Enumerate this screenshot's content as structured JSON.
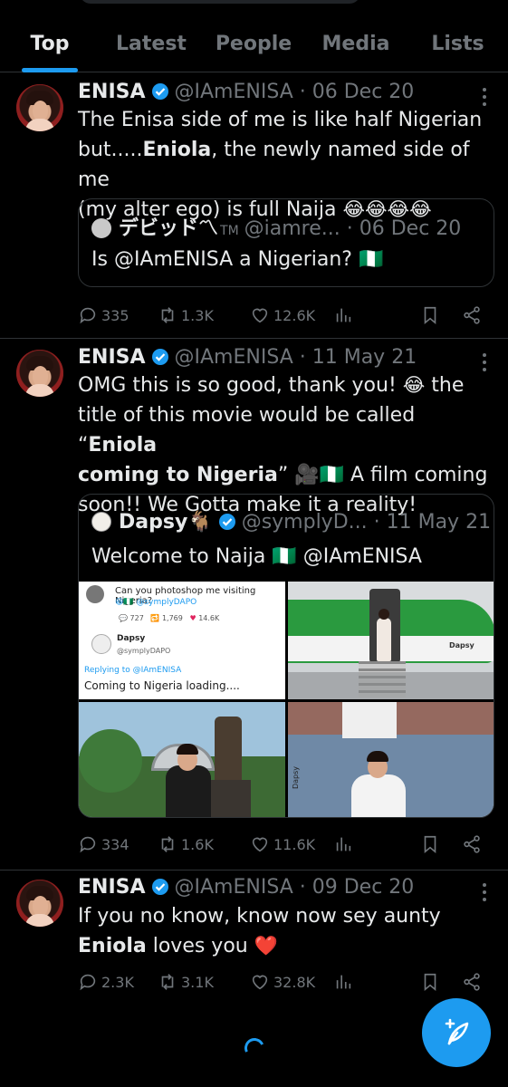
{
  "tabs": [
    {
      "label": "Top",
      "active": true
    },
    {
      "label": "Latest",
      "active": false
    },
    {
      "label": "People",
      "active": false
    },
    {
      "label": "Media",
      "active": false
    },
    {
      "label": "Lists",
      "active": false
    }
  ],
  "colors": {
    "accent": "#1d9bf0",
    "background": "#000000",
    "muted": "#71767b",
    "text": "#e7e9ea",
    "heart": "#e0245e"
  },
  "tweets": [
    {
      "name": "ENISA",
      "handle": "@IAmENISA",
      "date": "· 06 Dec 20",
      "text_lines": [
        "The Enisa side of me is like half Nigerian",
        {
          "pre": "but.....",
          "bold": "Eniola",
          "post": ", the newly named side of me"
        },
        {
          "pre": "(my alter ego) is full Naija ",
          "emoji": "😂😂😂😂"
        }
      ],
      "quote": {
        "name": "デビッド〽",
        "tm": "TM",
        "handle": "@iamre...",
        "date": "· 06 Dec 20",
        "text": "Is @IAmENISA a Nigerian? 🇳🇬"
      },
      "stats": {
        "replies": "335",
        "retweets": "1.3K",
        "likes": "12.6K"
      }
    },
    {
      "name": "ENISA",
      "handle": "@IAmENISA",
      "date": "· 11 May 21",
      "text_lines": [
        {
          "pre": "OMG this is so good, thank you! ",
          "emoji": "😂",
          "post": " the"
        },
        {
          "pre": "title of this movie would be called “",
          "bold": "Eniola"
        },
        {
          "bold": "coming to Nigeria",
          "post": "” 🎥🇳🇬 A film coming"
        },
        "soon!! We Gotta make it a reality!"
      ],
      "quote": {
        "name": "Dapsy🐐",
        "handle": "@symplyD...",
        "date": "· 11 May 21",
        "text": "Welcome to Naija 🇳🇬 @IAmENISA",
        "media": {
          "screenshot": {
            "question": "Can you photoshop me visiting Nigeria?",
            "sub_handle": "😆🇳🇬 @symplyDAPO",
            "stats": [
              "727",
              "1,769",
              "14.6K"
            ],
            "reply_name": "Dapsy",
            "reply_handle": "@symplyDAPO",
            "replying_to": "Replying to @IAmENISA",
            "reply_text": "Coming to Nigeria loading...."
          },
          "plane_watermark": "Dapsy",
          "photo_watermark": "Dapsy"
        }
      },
      "stats": {
        "replies": "334",
        "retweets": "1.6K",
        "likes": "11.6K"
      }
    },
    {
      "name": "ENISA",
      "handle": "@IAmENISA",
      "date": "· 09 Dec 20",
      "text_lines": [
        "If you no know, know now sey aunty",
        {
          "bold": "Eniola",
          "post": " loves you ",
          "emoji": "❤️"
        }
      ],
      "stats": {
        "replies": "2.3K",
        "retweets": "3.1K",
        "likes": "32.8K"
      }
    }
  ],
  "icons": {
    "reply": "reply-icon",
    "retweet": "retweet-icon",
    "like": "heart-icon",
    "views": "views-icon",
    "bookmark": "bookmark-icon",
    "share": "share-icon",
    "compose": "compose-icon"
  }
}
